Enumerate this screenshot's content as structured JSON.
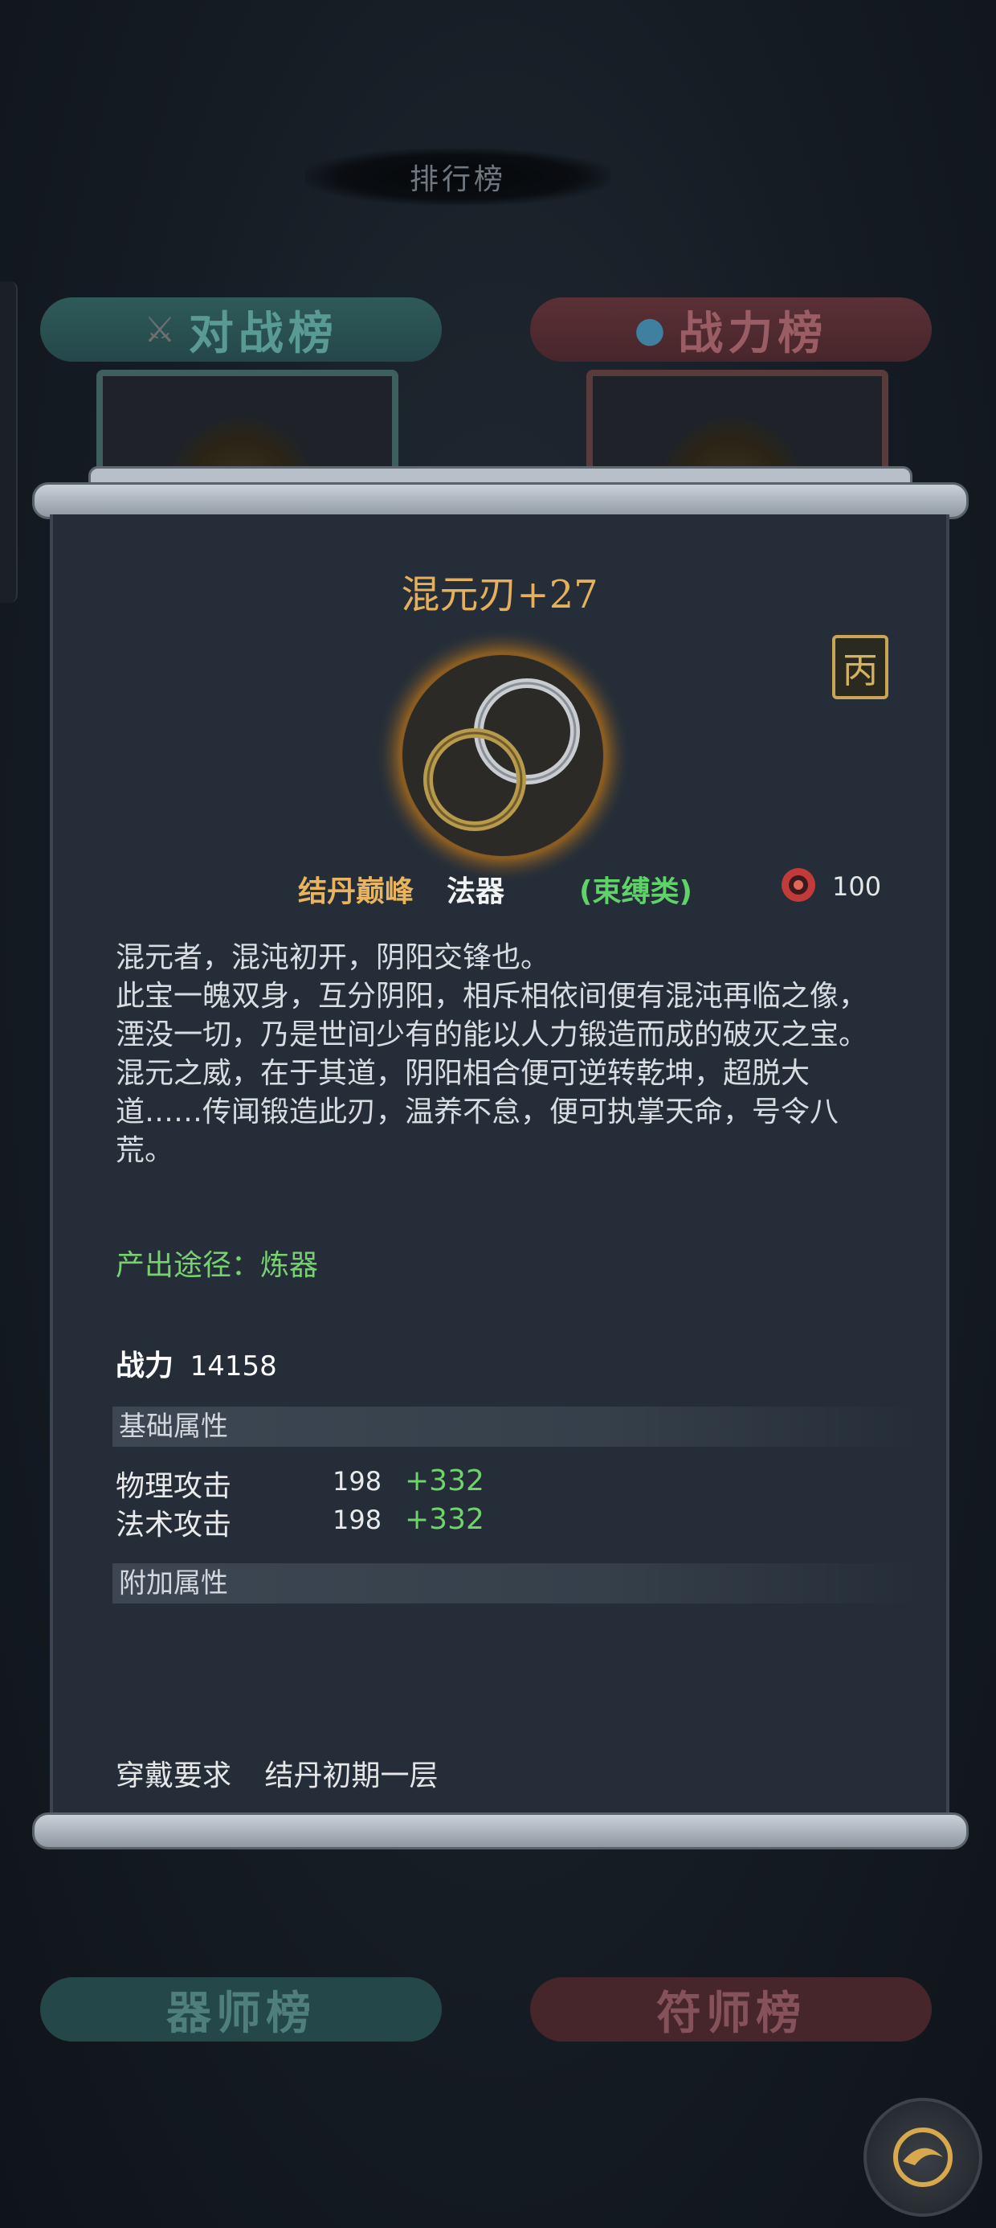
{
  "background": {
    "title": "排行榜",
    "cards": [
      {
        "label": "对战榜"
      },
      {
        "label": "战力榜"
      },
      {
        "label": "器师榜"
      },
      {
        "label": "符师榜"
      }
    ]
  },
  "item": {
    "name": "混元刃+27",
    "seal_char": "丙",
    "grade": "结丹巅峰",
    "type": "法器",
    "category": "(束缚类)",
    "power_value": "100",
    "description": [
      "混元者，混沌初开，阴阳交锋也。",
      "此宝一魄双身，互分阴阳，相斥相依间便有混沌再临之像，湮没一切，乃是世间少有的能以人力锻造而成的破灭之宝。",
      "混元之威，在于其道，阴阳相合便可逆转乾坤，超脱大道……传闻锻造此刃，温养不怠，便可执掌天命，号令八荒。"
    ],
    "source": "产出途径：炼器",
    "combat_label": "战力",
    "combat_value": "14158",
    "base_section": "基础属性",
    "stats": [
      {
        "name": "物理攻击",
        "base": "198",
        "bonus": "+332"
      },
      {
        "name": "法术攻击",
        "base": "198",
        "bonus": "+332"
      }
    ],
    "extra_section": "附加属性",
    "require_label": "穿戴要求",
    "require_value": "结丹初期一层"
  },
  "colors": {
    "item_name": "#e4b05c",
    "grade": "#e8b45f",
    "category": "#5fd26a",
    "bonus": "#6fd36c",
    "source": "#78d072"
  }
}
